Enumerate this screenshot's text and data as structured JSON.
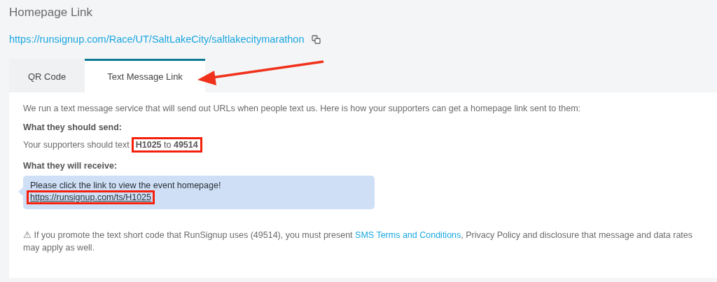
{
  "section_title": "Homepage Link",
  "homepage_url": "https://runsignup.com/Race/UT/SaltLakeCity/saltlakecitymarathon",
  "tabs": [
    {
      "label": "QR Code",
      "selected": false
    },
    {
      "label": "Text Message Link",
      "selected": true
    }
  ],
  "tab_arrow": true,
  "intro": "We run a text message service that will send out URLs when people text us. Here is how your supporters can get a homepage link sent to them:",
  "send_heading": "What they should send:",
  "send_text": "Your supporters should text",
  "send_code": {
    "text": "**H1025** to **49514**",
    "highlighted": true
  },
  "receive_heading": "What they will receive:",
  "message": {
    "text": "Please click the link to view the event homepage!",
    "link": "https://runsignup.com/ts/H1025",
    "link_highlighted": true
  },
  "note": {
    "before": "⚠ If you promote the text short code that RunSignup uses (49514), you must present",
    "link": "SMS Terms and Conditions",
    "after": ", Privacy Policy and disclosure that message and data rates may apply as well."
  }
}
